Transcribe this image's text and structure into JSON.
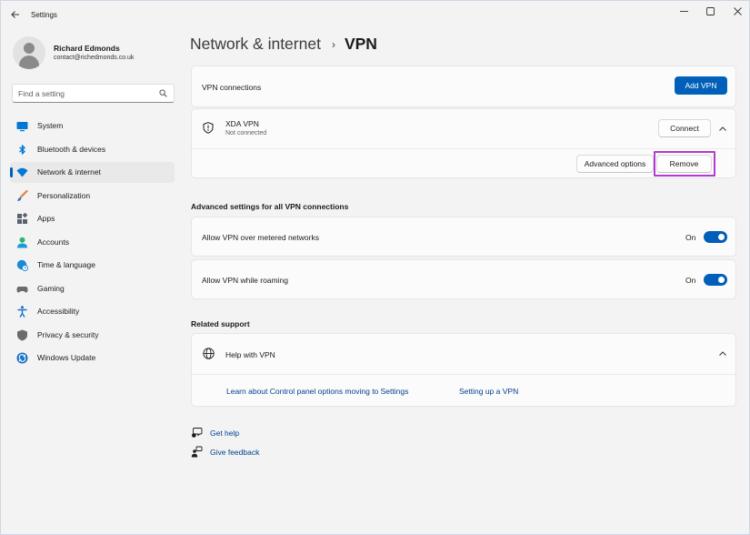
{
  "window": {
    "title": "Settings",
    "controls": {
      "minimize": "minimize-icon",
      "maximize": "maximize-icon",
      "close": "close-icon"
    }
  },
  "user": {
    "name": "Richard Edmonds",
    "email": "contact@richedmonds.co.uk"
  },
  "search": {
    "placeholder": "Find a setting",
    "icon": "search-icon"
  },
  "sidebar": {
    "items": [
      {
        "label": "System",
        "icon": "system-icon",
        "color": "#0078d4"
      },
      {
        "label": "Bluetooth & devices",
        "icon": "bluetooth-icon",
        "color": "#0078d4"
      },
      {
        "label": "Network & internet",
        "icon": "wifi-icon",
        "color": "#0078d4",
        "active": true
      },
      {
        "label": "Personalization",
        "icon": "paintbrush-icon",
        "color": "#e3803b"
      },
      {
        "label": "Apps",
        "icon": "apps-icon",
        "color": "#5a6170"
      },
      {
        "label": "Accounts",
        "icon": "accounts-icon",
        "color": "#2bb673"
      },
      {
        "label": "Time & language",
        "icon": "globe-clock-icon",
        "color": "#1a8ad4"
      },
      {
        "label": "Gaming",
        "icon": "gamepad-icon",
        "color": "#6b6b6b"
      },
      {
        "label": "Accessibility",
        "icon": "accessibility-icon",
        "color": "#1a72c9"
      },
      {
        "label": "Privacy & security",
        "icon": "shield-icon",
        "color": "#6b6b6b"
      },
      {
        "label": "Windows Update",
        "icon": "windows-update-icon",
        "color": "#1a72c9"
      }
    ]
  },
  "breadcrumb": {
    "parent": "Network & internet",
    "separator": "›",
    "current": "VPN"
  },
  "vpn_connections": {
    "label": "VPN connections",
    "add_button": "Add VPN",
    "connection": {
      "name": "XDA VPN",
      "status": "Not connected",
      "icon": "vpn-shield-icon",
      "connect_button": "Connect",
      "advanced_button": "Advanced options",
      "remove_button": "Remove"
    }
  },
  "advanced": {
    "title": "Advanced settings for all VPN connections",
    "rows": [
      {
        "label": "Allow VPN over metered networks",
        "state": "On",
        "on": true
      },
      {
        "label": "Allow VPN while roaming",
        "state": "On",
        "on": true
      }
    ]
  },
  "related": {
    "title": "Related support",
    "help_label": "Help with VPN",
    "links": [
      "Learn about Control panel options moving to Settings",
      "Setting up a VPN"
    ]
  },
  "footer": {
    "get_help": "Get help",
    "give_feedback": "Give feedback"
  },
  "colors": {
    "accent": "#005fb8",
    "highlight": "#b43bd1",
    "link": "#003e92"
  }
}
